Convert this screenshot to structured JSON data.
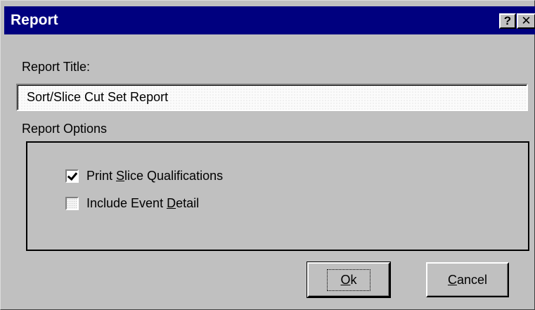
{
  "window": {
    "title": "Report",
    "help_label": "?",
    "close_label": "✕"
  },
  "report_title": {
    "label": "Report Title:",
    "value": "Sort/Slice Cut Set Report"
  },
  "report_options": {
    "label": "Report Options",
    "print_slice_qualifications": {
      "label_prefix": "Print ",
      "label_mnemonic": "S",
      "label_suffix": "lice Qualifications",
      "checked": true
    },
    "include_event_detail": {
      "label_prefix": "Include Event ",
      "label_mnemonic": "D",
      "label_suffix": "etail",
      "checked": false
    }
  },
  "buttons": {
    "ok": {
      "mnemonic": "O",
      "rest": "k"
    },
    "cancel": {
      "mnemonic": "C",
      "rest": "ancel"
    }
  }
}
